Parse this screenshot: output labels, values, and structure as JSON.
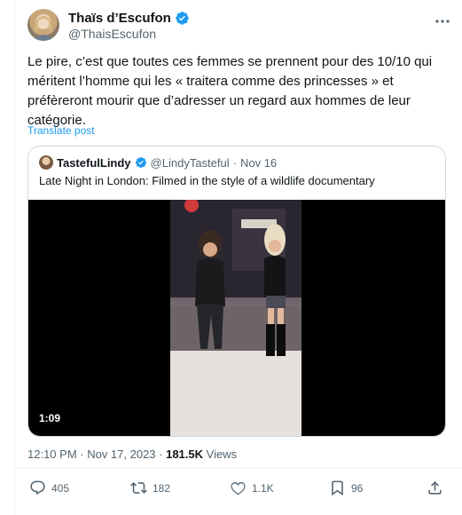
{
  "author": {
    "name": "Thaïs d’Escufon",
    "handle": "@ThaisEscufon"
  },
  "tweet": {
    "text": "Le pire, c’est que toutes ces femmes se prennent pour des 10/10 qui méritent l’homme qui les « traitera comme des princesses » et préfèreront mourir que d’adresser un regard aux hommes de leur catégorie.",
    "translate_label": "Translate post",
    "time": "12:10 PM · Nov 17, 2023 · ",
    "views_count": "181.5K",
    "views_label": " Views"
  },
  "quote": {
    "name": "TastefulLindy",
    "handle": "@LindyTasteful",
    "separator": " · ",
    "date": "Nov 16",
    "text": "Late Night in London:  Filmed in the style of a wildlife documentary",
    "video_duration": "1:09"
  },
  "actions": {
    "replies": "405",
    "reposts": "182",
    "likes": "1.1K",
    "bookmarks": "96"
  },
  "colors": {
    "accent": "#1d9bf0",
    "muted": "#536471",
    "text": "#0f1419"
  }
}
